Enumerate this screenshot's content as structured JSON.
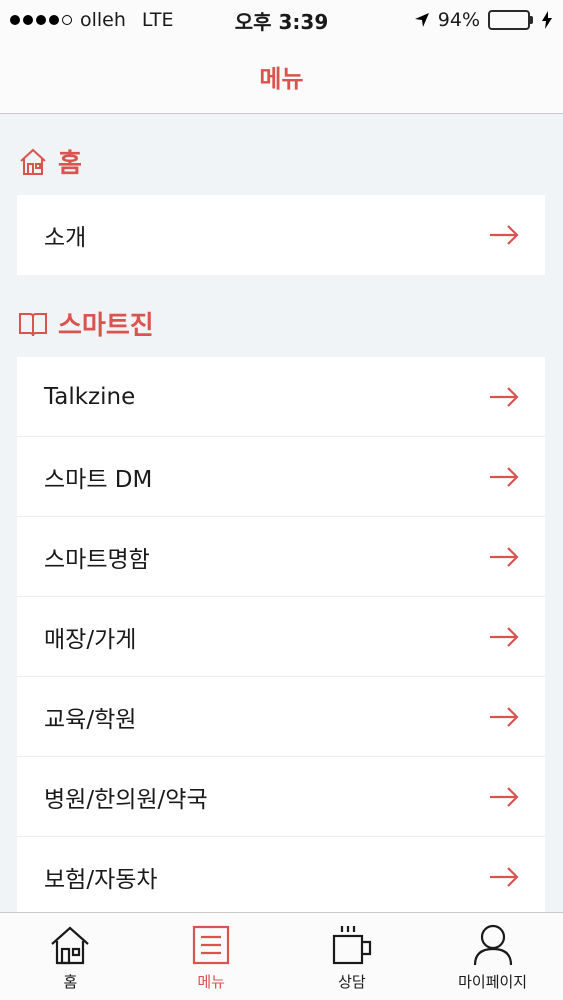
{
  "status": {
    "carrier": "olleh",
    "network": "LTE",
    "time": "오후 3:39",
    "battery_pct": "94%",
    "battery_level": 0.94,
    "signal_bars": 4
  },
  "nav": {
    "title": "메뉴"
  },
  "sections": {
    "home": {
      "title": "홈",
      "icon": "house-icon",
      "items": [
        {
          "label": "소개"
        }
      ]
    },
    "smartzine": {
      "title": "스마트진",
      "icon": "book-icon",
      "items": [
        {
          "label": "Talkzine"
        },
        {
          "label": "스마트 DM"
        },
        {
          "label": "스마트명함"
        },
        {
          "label": "매장/가게"
        },
        {
          "label": "교육/학원"
        },
        {
          "label": "병원/한의원/약국"
        },
        {
          "label": "보험/자동차"
        }
      ]
    }
  },
  "tabs": [
    {
      "label": "홈",
      "icon": "home-icon"
    },
    {
      "label": "메뉴",
      "icon": "menu-icon",
      "active": true
    },
    {
      "label": "상담",
      "icon": "coffee-cup-icon"
    },
    {
      "label": "마이페이지",
      "icon": "person-icon"
    }
  ],
  "colors": {
    "accent": "#d9534f",
    "background": "#f0f4f7",
    "battery": "#4cd964"
  }
}
